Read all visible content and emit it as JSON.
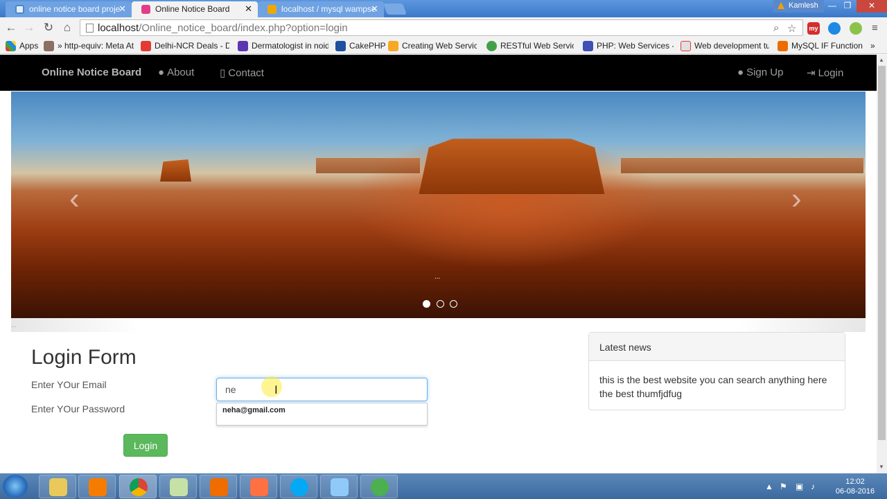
{
  "browser": {
    "tabs": [
      {
        "title": "online notice board proje",
        "close": "✕"
      },
      {
        "title": "Online Notice Board",
        "close": "✕"
      },
      {
        "title": "localhost / mysql wampse",
        "close": "✕"
      }
    ],
    "profile_name": "Kamlesh",
    "window_controls": {
      "minimize": "—",
      "maximize": "❐",
      "close": "✕"
    },
    "url_host": "localhost",
    "url_path": "/Online_notice_board/index.php?option=login",
    "nav_icons": {
      "back": "←",
      "forward": "→",
      "reload": "↻",
      "home": "⌂"
    },
    "extensions": [
      "my"
    ],
    "bookmarks": [
      "Apps",
      "» http-equiv: Meta At",
      "Delhi-NCR Deals - Da",
      "Dermatologist in noid",
      "CakePHP",
      "Creating Web Service",
      "RESTful Web Services",
      "PHP: Web Services - N",
      "Web development tut",
      "MySQL IF Function"
    ],
    "bookmarks_overflow": "»"
  },
  "site": {
    "brand": "Online Notice Board",
    "nav_left": [
      "About",
      "Contact"
    ],
    "nav_right": [
      "Sign Up",
      "Login"
    ],
    "carousel": {
      "prev": "‹",
      "next": "›",
      "slide_count": 3,
      "active_slide": 1,
      "caption": "..."
    },
    "carousel_caption_bottom": "..."
  },
  "login": {
    "title": "Login Form",
    "email_label": "Enter YOur Email",
    "password_label": "Enter YOur Password",
    "email_value": "ne",
    "autocomplete_option": "neha@gmail.com",
    "button": "Login",
    "ibeam": "I"
  },
  "news": {
    "heading": "Latest news",
    "body": "this is the best website you can search anything here the best thumfjdfug"
  },
  "taskbar": {
    "clock_time": "12:02",
    "clock_date": "06-08-2016"
  },
  "colors": {
    "navbar_bg": "#000000",
    "login_button": "#5cb85c",
    "input_focus": "#66afe9"
  }
}
